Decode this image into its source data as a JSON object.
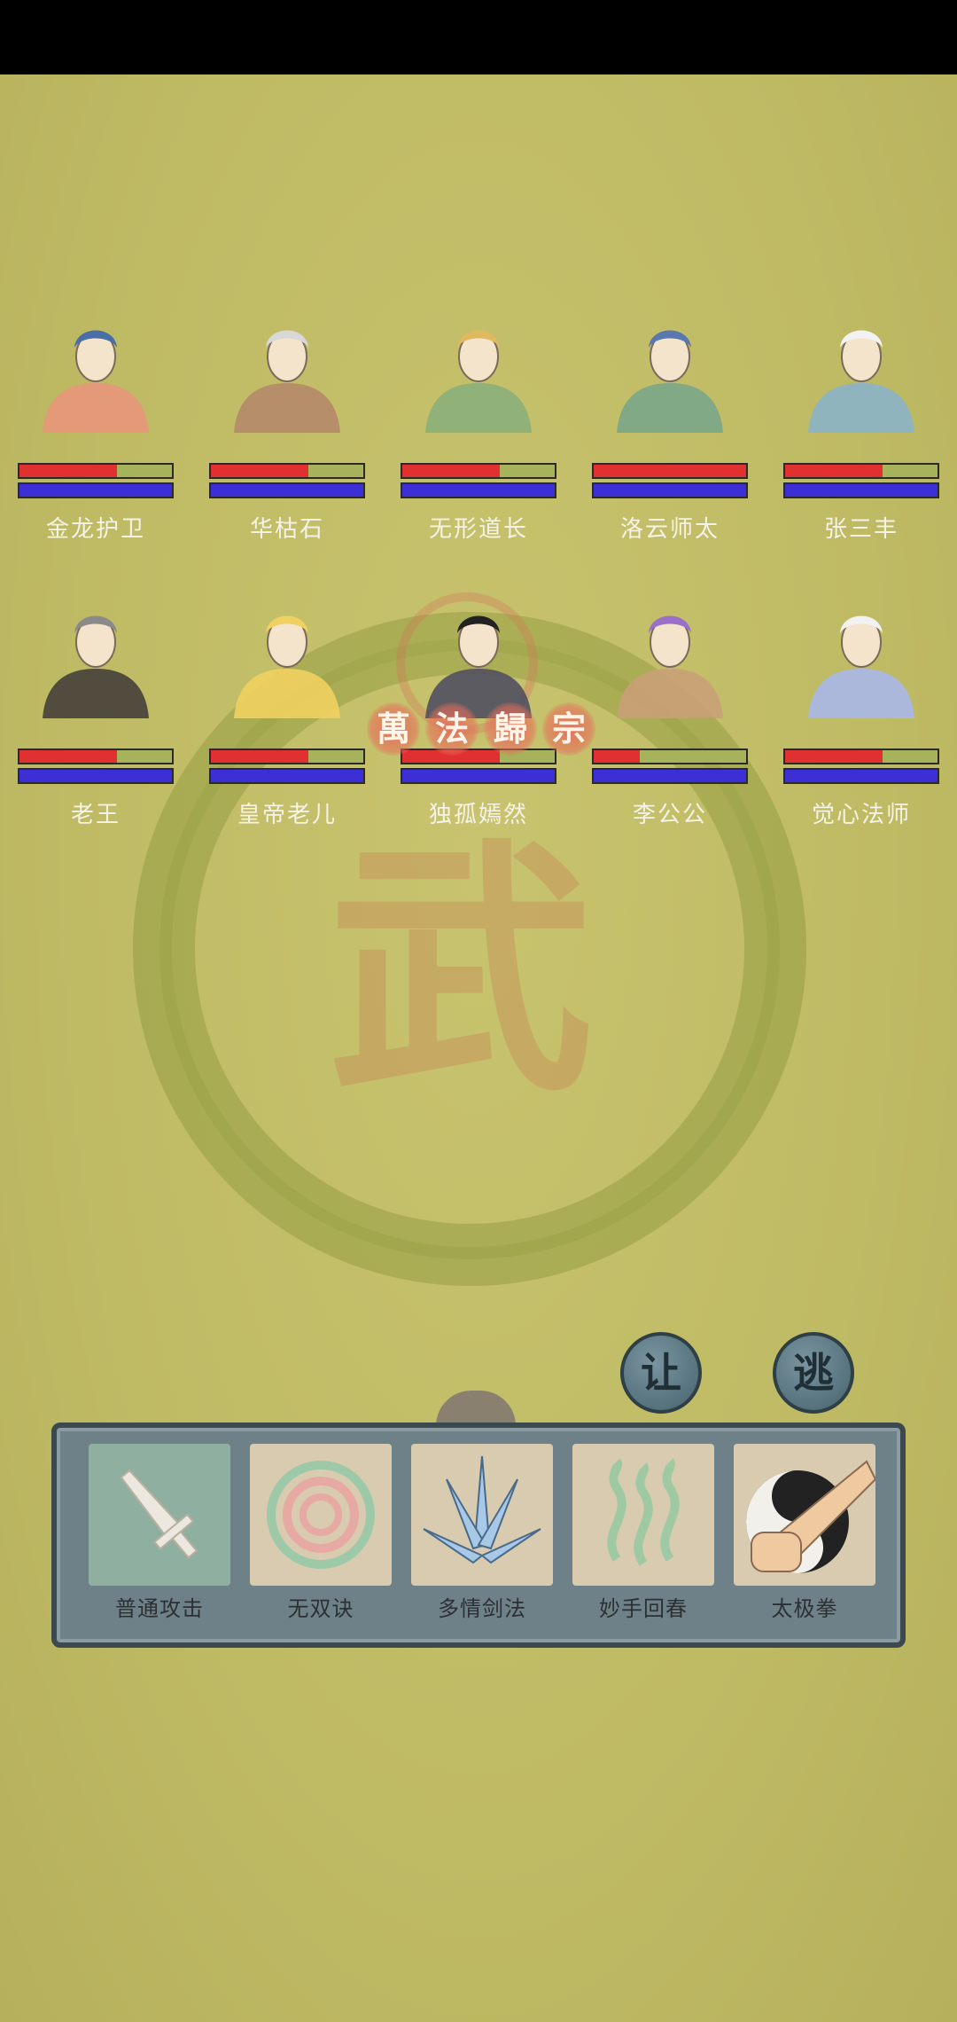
{
  "characters": [
    {
      "name": "金龙护卫",
      "hp": 0.64,
      "mp": 1.0,
      "robe": "#e8967a",
      "hair": "#4a6ea8"
    },
    {
      "name": "华枯石",
      "hp": 0.64,
      "mp": 1.0,
      "robe": "#b58a6a",
      "hair": "#d8d8d8"
    },
    {
      "name": "无形道长",
      "hp": 0.64,
      "mp": 1.0,
      "robe": "#8bb07a",
      "hair": "#e0b860"
    },
    {
      "name": "洛云师太",
      "hp": 1.0,
      "mp": 1.0,
      "robe": "#7aa68a",
      "hair": "#5a78b0"
    },
    {
      "name": "张三丰",
      "hp": 0.64,
      "mp": 1.0,
      "robe": "#8ab4c8",
      "hair": "#f2f2f2"
    },
    {
      "name": "老王",
      "hp": 0.64,
      "mp": 1.0,
      "robe": "#454038",
      "hair": "#8a8a8a"
    },
    {
      "name": "皇帝老儿",
      "hp": 0.64,
      "mp": 1.0,
      "robe": "#f0d060",
      "hair": "#f0d060"
    },
    {
      "name": "独孤嫣然",
      "hp": 0.64,
      "mp": 1.0,
      "robe": "#505060",
      "hair": "#222222"
    },
    {
      "name": "李公公",
      "hp": 0.3,
      "mp": 1.0,
      "robe": "#c8a078",
      "hair": "#9a70c8"
    },
    {
      "name": "觉心法师",
      "hp": 0.64,
      "mp": 1.0,
      "robe": "#a8b8e8",
      "hair": "#f2f2f2"
    }
  ],
  "banner": {
    "chars": [
      "萬",
      "法",
      "歸",
      "宗"
    ]
  },
  "actions": {
    "yield_label": "让",
    "flee_label": "逃"
  },
  "skills": [
    {
      "label": "普通攻击",
      "icon": "sword-icon",
      "bg": "#8fb0a0"
    },
    {
      "label": "无双诀",
      "icon": "spiral-icon",
      "bg": "#d9cbb0"
    },
    {
      "label": "多情剑法",
      "icon": "swords-fan-icon",
      "bg": "#d9cbb0"
    },
    {
      "label": "妙手回春",
      "icon": "healing-waves-icon",
      "bg": "#d9cbb0"
    },
    {
      "label": "太极拳",
      "icon": "yin-yang-fist-icon",
      "bg": "#d9cbb0"
    }
  ],
  "colors": {
    "background": "#c4bf6a",
    "hp": "#e03030",
    "mp": "#3d2fd6",
    "panel": "#6e8088",
    "name_text": "#f5f3e8"
  }
}
